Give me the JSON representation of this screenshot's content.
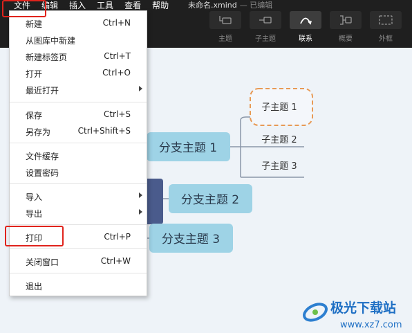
{
  "menubar": [
    "文件",
    "编辑",
    "插入",
    "工具",
    "查看",
    "帮助"
  ],
  "doc_title": "未命名.xmind",
  "doc_status": "— 已编辑",
  "toolbar": [
    {
      "name": "topic",
      "label": "主题",
      "icon": "topic-icon"
    },
    {
      "name": "subtopic",
      "label": "子主题",
      "icon": "subtopic-icon"
    },
    {
      "name": "relationship",
      "label": "联系",
      "icon": "relationship-icon",
      "active": true
    },
    {
      "name": "summary",
      "label": "概要",
      "icon": "summary-icon"
    },
    {
      "name": "boundary",
      "label": "外框",
      "icon": "boundary-icon"
    }
  ],
  "file_menu": {
    "groups": [
      [
        {
          "label": "新建",
          "shortcut": "Ctrl+N"
        },
        {
          "label": "从图库中新建",
          "shortcut": ""
        },
        {
          "label": "新建标签页",
          "shortcut": "Ctrl+T"
        },
        {
          "label": "打开",
          "shortcut": "Ctrl+O"
        },
        {
          "label": "最近打开",
          "shortcut": "",
          "submenu": true
        }
      ],
      [
        {
          "label": "保存",
          "shortcut": "Ctrl+S"
        },
        {
          "label": "另存为",
          "shortcut": "Ctrl+Shift+S"
        }
      ],
      [
        {
          "label": "文件缓存",
          "shortcut": ""
        },
        {
          "label": "设置密码",
          "shortcut": ""
        }
      ],
      [
        {
          "label": "导入",
          "shortcut": "",
          "submenu": true
        },
        {
          "label": "导出",
          "shortcut": "",
          "submenu": true
        }
      ],
      [
        {
          "label": "打印",
          "shortcut": "Ctrl+P"
        }
      ],
      [
        {
          "label": "关闭窗口",
          "shortcut": "Ctrl+W"
        }
      ],
      [
        {
          "label": "退出",
          "shortcut": ""
        }
      ]
    ]
  },
  "mindmap": {
    "branches": [
      "分支主题 1",
      "分支主题 2",
      "分支主题 3"
    ],
    "subtopics": [
      "子主题 1",
      "子主题 2",
      "子主题 3"
    ]
  },
  "watermark": {
    "title": "极光下载站",
    "url": "www.xz7.com"
  },
  "colors": {
    "branch_fill": "#9ed3e6",
    "central_fill": "#4a5b8c",
    "highlight": "#e0231c",
    "selection": "#e89a55"
  }
}
